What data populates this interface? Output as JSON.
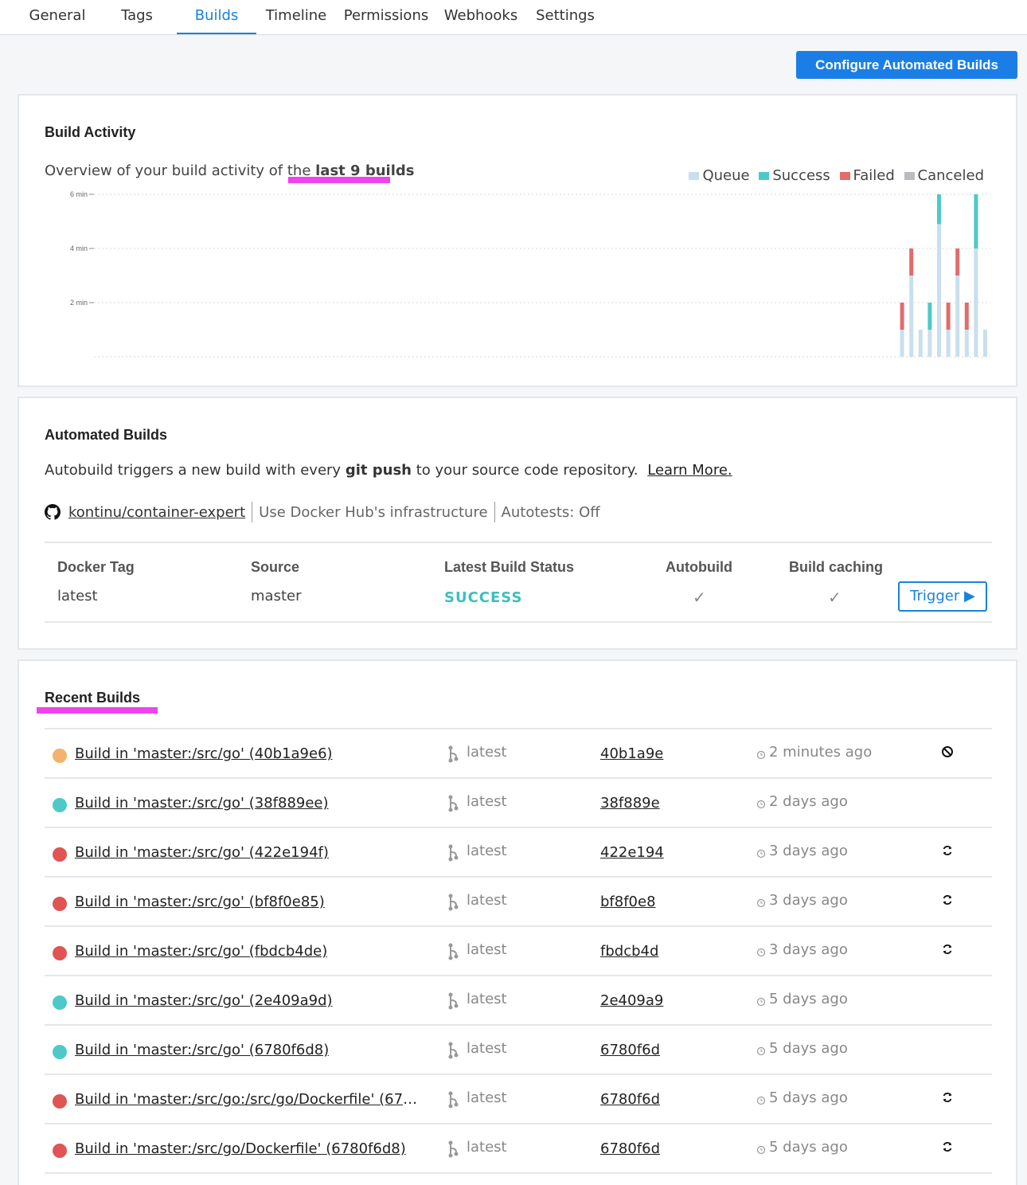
{
  "tabs": [
    {
      "label": "General"
    },
    {
      "label": "Tags"
    },
    {
      "label": "Builds"
    },
    {
      "label": "Timeline"
    },
    {
      "label": "Permissions"
    },
    {
      "label": "Webhooks"
    },
    {
      "label": "Settings"
    }
  ],
  "configure_button": "Configure Automated Builds",
  "build_activity": {
    "title": "Build Activity",
    "overview_prefix": "Overview of your build activity of the",
    "overview_highlight": "last 9 builds",
    "legend": [
      {
        "name": "Queue",
        "color": "#c9dfee"
      },
      {
        "name": "Success",
        "color": "#4ec9c9"
      },
      {
        "name": "Failed",
        "color": "#e36b6b"
      },
      {
        "name": "Canceled",
        "color": "#b9bdc2"
      }
    ]
  },
  "chart_data": {
    "type": "bar",
    "stacked": true,
    "ylabel": "",
    "ylim": [
      0,
      6
    ],
    "yticks": [
      "6 min",
      "4 min",
      "2 min"
    ],
    "yunit": "min",
    "grid": true,
    "legend_position": "top-right",
    "series": [
      {
        "name": "Queue",
        "color": "#c9dfee",
        "values": [
          1.0,
          3.0,
          1.0,
          1.0,
          4.9,
          1.0,
          3.0,
          1.0,
          4.0,
          1.0
        ]
      },
      {
        "name": "Success",
        "color": "#4ec9c9",
        "values": [
          0,
          0,
          0,
          1.0,
          1.1,
          0,
          0,
          0,
          2.0,
          0
        ]
      },
      {
        "name": "Failed",
        "color": "#e36b6b",
        "values": [
          1.0,
          1.0,
          0,
          0,
          0,
          1.0,
          1.0,
          1.0,
          0,
          0
        ]
      },
      {
        "name": "Canceled",
        "color": "#b9bdc2",
        "values": [
          0,
          0,
          0,
          0,
          0,
          0,
          0,
          0,
          0,
          0
        ]
      }
    ]
  },
  "automated_builds": {
    "title": "Automated Builds",
    "desc_prefix": "Autobuild triggers a new build with every",
    "desc_bold": "git push",
    "desc_suffix": "to your source code repository.",
    "learn_more": "Learn More.",
    "repo": "kontinu/container-expert",
    "infra": "Use Docker Hub's infrastructure",
    "autotests": "Autotests: Off",
    "headers": {
      "tag": "Docker Tag",
      "source": "Source",
      "status": "Latest Build Status",
      "autobuild": "Autobuild",
      "caching": "Build caching"
    },
    "row": {
      "tag": "latest",
      "source": "master",
      "status": "SUCCESS",
      "autobuild": "✓",
      "caching": "✓",
      "trigger": "Trigger ▶"
    }
  },
  "recent_builds": {
    "title": "Recent Builds",
    "builds": [
      {
        "name": "Build in 'master:/src/go' (40b1a9e6)",
        "status": "queued",
        "tag": "latest",
        "commit": "40b1a9e",
        "time": "2 minutes ago",
        "action": "cancel"
      },
      {
        "name": "Build in 'master:/src/go' (38f889ee)",
        "status": "success",
        "tag": "latest",
        "commit": "38f889e",
        "time": "2 days ago",
        "action": ""
      },
      {
        "name": "Build in 'master:/src/go' (422e194f)",
        "status": "failed",
        "tag": "latest",
        "commit": "422e194",
        "time": "3 days ago",
        "action": "retry"
      },
      {
        "name": "Build in 'master:/src/go' (bf8f0e85)",
        "status": "failed",
        "tag": "latest",
        "commit": "bf8f0e8",
        "time": "3 days ago",
        "action": "retry"
      },
      {
        "name": "Build in 'master:/src/go' (fbdcb4de)",
        "status": "failed",
        "tag": "latest",
        "commit": "fbdcb4d",
        "time": "3 days ago",
        "action": "retry"
      },
      {
        "name": "Build in 'master:/src/go' (2e409a9d)",
        "status": "success",
        "tag": "latest",
        "commit": "2e409a9",
        "time": "5 days ago",
        "action": ""
      },
      {
        "name": "Build in 'master:/src/go' (6780f6d8)",
        "status": "success",
        "tag": "latest",
        "commit": "6780f6d",
        "time": "5 days ago",
        "action": ""
      },
      {
        "name": "Build in 'master:/src/go:/src/go/Dockerfile' (6780f6…",
        "status": "failed",
        "tag": "latest",
        "commit": "6780f6d",
        "time": "5 days ago",
        "action": "retry"
      },
      {
        "name": "Build in 'master:/src/go/Dockerfile' (6780f6d8)",
        "status": "failed",
        "tag": "latest",
        "commit": "6780f6d",
        "time": "5 days ago",
        "action": "retry"
      }
    ]
  }
}
